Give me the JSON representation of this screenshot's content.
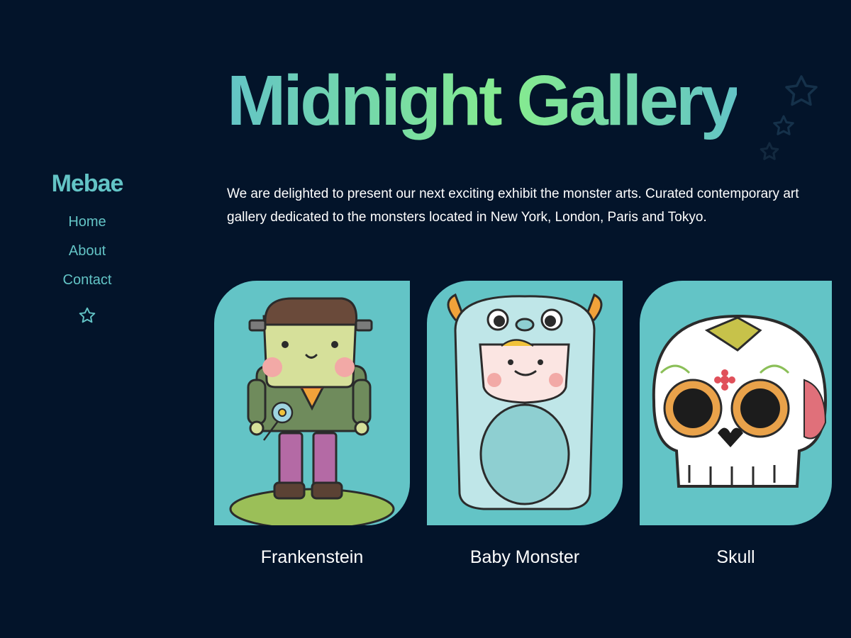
{
  "sidebar": {
    "brand": "Mebae",
    "nav": [
      {
        "label": "Home"
      },
      {
        "label": "About"
      },
      {
        "label": "Contact"
      }
    ],
    "star_icon": "star-outline-icon"
  },
  "header": {
    "title": "Midnight Gallery"
  },
  "intro": {
    "text": "We are delighted to present our next exciting exhibit the monster arts. Curated contemporary art gallery dedicated to the monsters located in New York, London, Paris and Tokyo."
  },
  "gallery": {
    "items": [
      {
        "label": "Frankenstein"
      },
      {
        "label": "Baby Monster"
      },
      {
        "label": "Skull"
      }
    ]
  },
  "colors": {
    "background": "#03142a",
    "accent": "#63c4c6",
    "accent_green": "#86ec8e",
    "text": "#ffffff"
  }
}
